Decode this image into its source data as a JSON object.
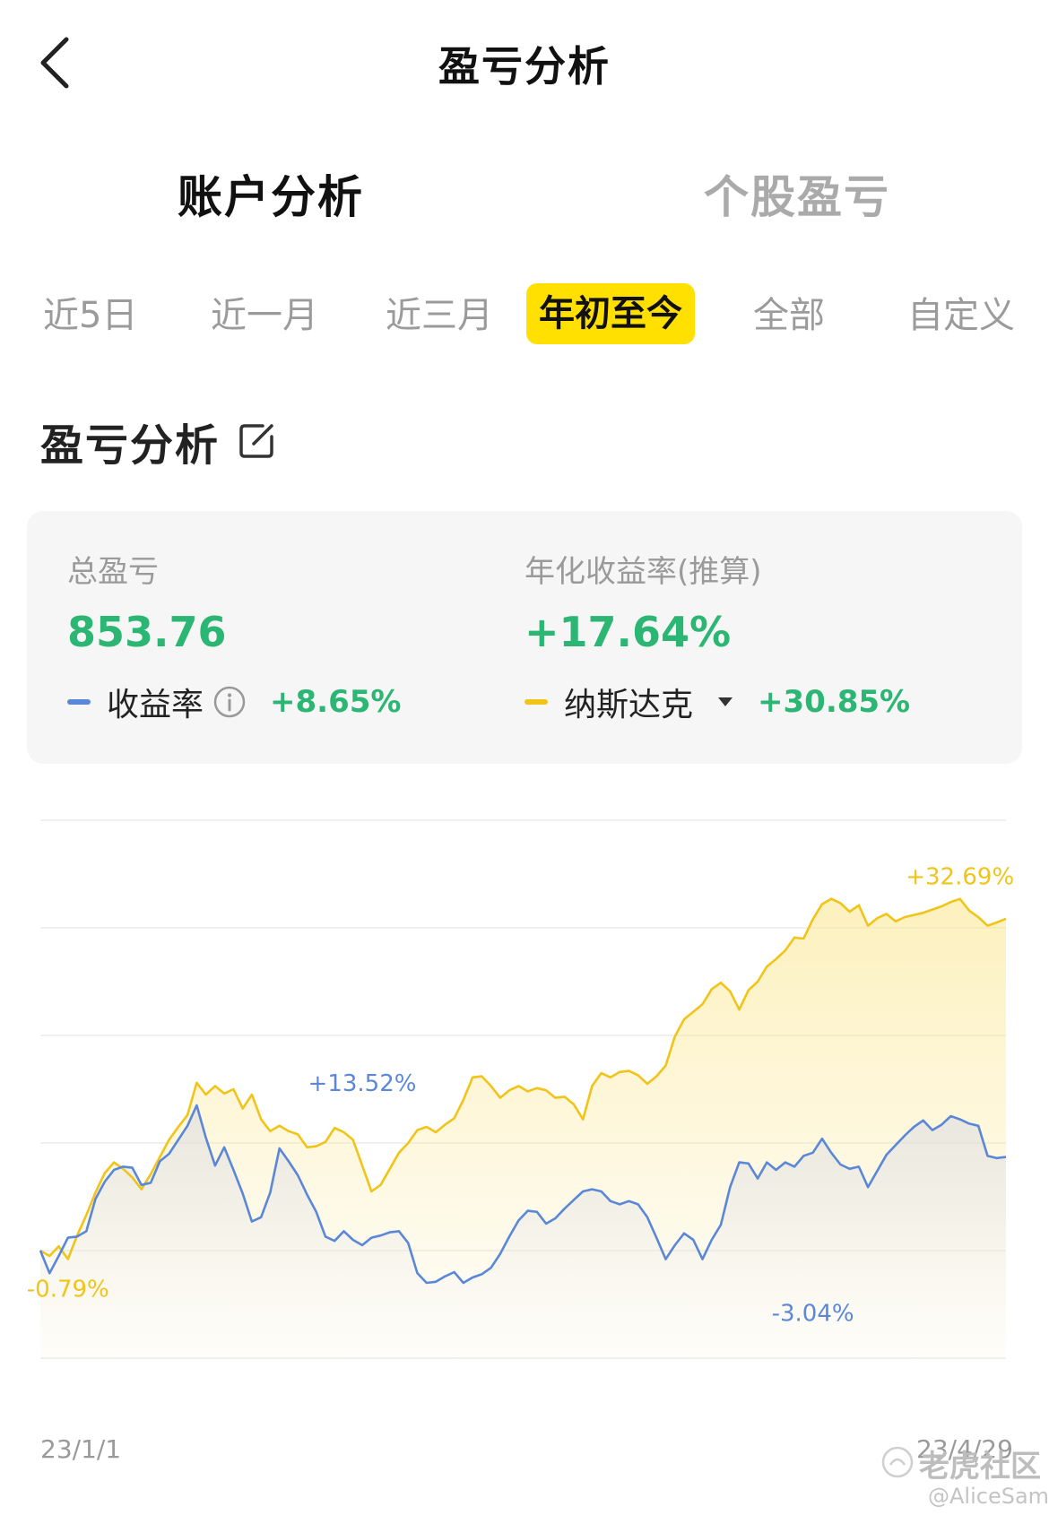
{
  "header": {
    "title": "盈亏分析"
  },
  "main_tabs": [
    {
      "label": "账户分析",
      "active": true
    },
    {
      "label": "个股盈亏",
      "active": false
    }
  ],
  "range_tabs": [
    {
      "label": "近5日",
      "active": false
    },
    {
      "label": "近一月",
      "active": false
    },
    {
      "label": "近三月",
      "active": false
    },
    {
      "label": "年初至今",
      "active": true
    },
    {
      "label": "全部",
      "active": false
    },
    {
      "label": "自定义",
      "active": false
    }
  ],
  "section": {
    "title": "盈亏分析"
  },
  "stats": {
    "total_label": "总盈亏",
    "total_value": "853.76",
    "annual_label": "年化收益率(推算)",
    "annual_value": "+17.64%",
    "return_name": "收益率",
    "return_value": "+8.65%",
    "benchmark_name": "纳斯达克",
    "benchmark_value": "+30.85%"
  },
  "colors": {
    "accent_yellow": "#ffe000",
    "gain_green": "#2bb673",
    "return_blue": "#5b87d9",
    "benchmark_yellow": "#f0c419"
  },
  "watermark": {
    "brand": "老虎社区",
    "user": "@AliceSam"
  },
  "chart_data": {
    "type": "line",
    "x_start_label": "23/1/1",
    "x_end_label": "23/4/29",
    "grid": true,
    "ylim": [
      -10,
      40
    ],
    "series": [
      {
        "name": "收益率",
        "color": "#5b87d9",
        "annotations": [
          {
            "label": "+13.52%",
            "index": 35,
            "value": 13.52
          },
          {
            "label": "-3.04%",
            "index": 84,
            "value": -3.04
          }
        ],
        "values": [
          0.0,
          -2.1,
          -0.5,
          1.2,
          1.3,
          1.8,
          4.8,
          6.4,
          7.5,
          7.8,
          7.7,
          6.1,
          6.3,
          8.3,
          9.0,
          10.3,
          11.6,
          13.5,
          10.5,
          7.9,
          9.6,
          7.5,
          5.3,
          2.7,
          3.1,
          5.4,
          9.5,
          8.3,
          7.0,
          5.2,
          3.6,
          1.3,
          0.9,
          1.8,
          1.0,
          0.5,
          1.2,
          1.4,
          1.7,
          1.8,
          0.7,
          -2.1,
          -3.0,
          -2.9,
          -2.4,
          -2.0,
          -3.0,
          -2.5,
          -2.2,
          -1.6,
          -0.3,
          1.3,
          2.8,
          3.7,
          3.6,
          2.5,
          3.0,
          3.9,
          4.7,
          5.5,
          5.7,
          5.5,
          4.6,
          4.3,
          4.6,
          4.3,
          3.1,
          1.2,
          -0.8,
          0.5,
          1.6,
          1.0,
          -0.8,
          1.0,
          2.4,
          5.9,
          8.2,
          8.1,
          6.7,
          8.2,
          7.5,
          8.2,
          7.8,
          8.8,
          9.1,
          10.4,
          9.1,
          8.0,
          7.6,
          7.8,
          5.9,
          7.4,
          8.9,
          9.8,
          10.7,
          11.5,
          12.1,
          11.2,
          11.7,
          12.5,
          12.2,
          11.8,
          11.6,
          8.8,
          8.6,
          8.7
        ]
      },
      {
        "name": "纳斯达克",
        "color": "#f0c419",
        "annotations": [
          {
            "label": "-0.79%",
            "index": 3,
            "value": -0.79
          },
          {
            "label": "+32.69%",
            "index": 100,
            "value": 32.69
          }
        ],
        "values": [
          0.0,
          -0.5,
          0.4,
          -0.79,
          1.4,
          3.3,
          5.4,
          7.2,
          8.2,
          7.6,
          6.8,
          5.7,
          7.1,
          8.7,
          10.3,
          11.5,
          12.6,
          15.6,
          14.5,
          15.3,
          14.6,
          15.0,
          13.2,
          14.5,
          12.2,
          11.1,
          11.6,
          11.1,
          10.8,
          9.6,
          9.7,
          10.1,
          11.4,
          11.0,
          10.3,
          7.9,
          5.5,
          6.1,
          7.6,
          9.1,
          10.0,
          11.2,
          11.5,
          11.0,
          11.7,
          12.3,
          14.0,
          16.1,
          16.2,
          15.3,
          14.2,
          14.9,
          15.3,
          14.8,
          15.1,
          14.9,
          14.2,
          14.3,
          13.6,
          12.2,
          15.3,
          16.5,
          16.1,
          16.6,
          16.7,
          16.3,
          15.5,
          16.2,
          17.2,
          19.9,
          21.5,
          22.2,
          22.9,
          24.3,
          24.9,
          24.1,
          22.4,
          24.2,
          25.0,
          26.4,
          27.1,
          27.9,
          29.1,
          29.0,
          30.8,
          32.2,
          32.7,
          32.3,
          31.5,
          32.1,
          30.2,
          30.9,
          31.3,
          30.6,
          31.0,
          31.2,
          31.4,
          31.7,
          32.0,
          32.4,
          32.69,
          31.6,
          31.0,
          30.2,
          30.5,
          30.85
        ]
      }
    ]
  }
}
